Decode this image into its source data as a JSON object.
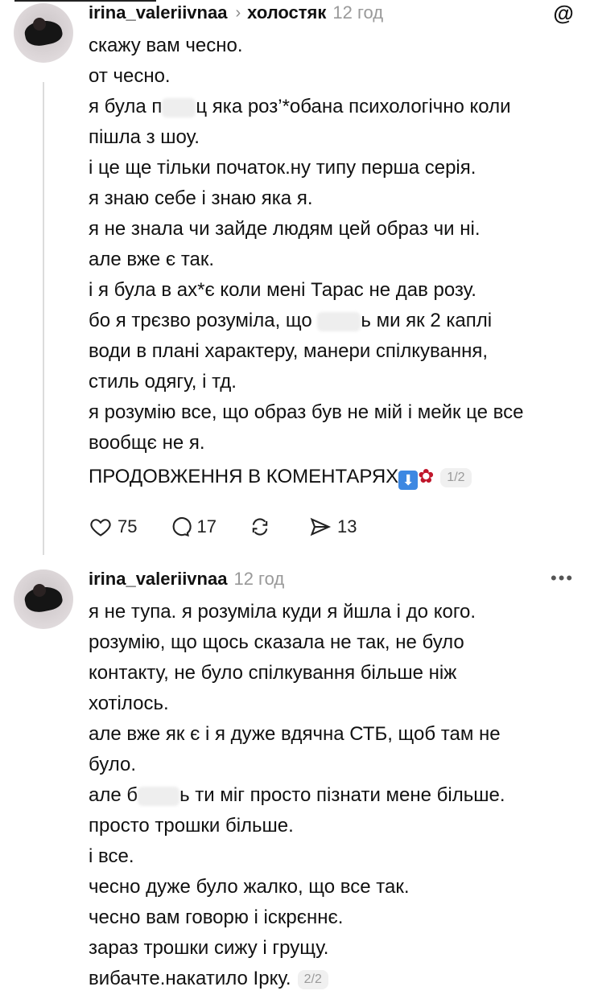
{
  "post1": {
    "username": "irina_valeriivnaa",
    "topic": "холостяк",
    "time": "12 год",
    "lines": [
      "скажу вам чесно.",
      "от чесно.",
      [
        "я була п",
        "ц яка  роз’*обана психологічно коли"
      ],
      "пішла з шоу.",
      "і це ще тільки початок.ну типу перша серія.",
      "я знаю себе і знаю яка я.",
      "я не знала чи зайде людям цей образ чи ні.",
      "але вже є так.",
      "і я була в ах*є коли мені Тарас не дав розу.",
      [
        "бо я трєзво розуміла, що ",
        "ь ми як 2 каплі"
      ],
      "води в плані характеру, манери спілкування,",
      "стиль одягу, і тд.",
      "я розумію все, що образ був не мій і мейк це все",
      "вообщє не я."
    ],
    "continuation": "ПРОДОВЖЕННЯ В КОМЕНТАРЯХ",
    "pager": "1/2",
    "likes": "75",
    "comments": "17",
    "shares": "13"
  },
  "post2": {
    "username": "irina_valeriivnaa",
    "time": "12 год",
    "lines": [
      "я не тупа.  я розуміла куди я йшла і до кого.",
      "розумію, що щось сказала не так, не було",
      "контакту, не було спілкування більше ніж",
      "хотілось.",
      "але вже як є і я дуже вдячна СТБ, щоб там не",
      "було.",
      [
        "але б",
        "ь ти міг просто пізнати мене більше."
      ],
      "просто трошки більше.",
      "і все.",
      "чесно дуже було жалко, що все так.",
      "чесно вам говорю і іскрєннє.",
      "зараз трошки сижу і грущу.",
      "вибачте.накатило Ірку."
    ],
    "pager": "2/2"
  },
  "icons": {
    "threads": "threads-logo-icon",
    "like": "heart-icon",
    "comment": "comment-bubble-icon",
    "repost": "repost-icon",
    "share": "send-icon",
    "more": "more-icon"
  }
}
